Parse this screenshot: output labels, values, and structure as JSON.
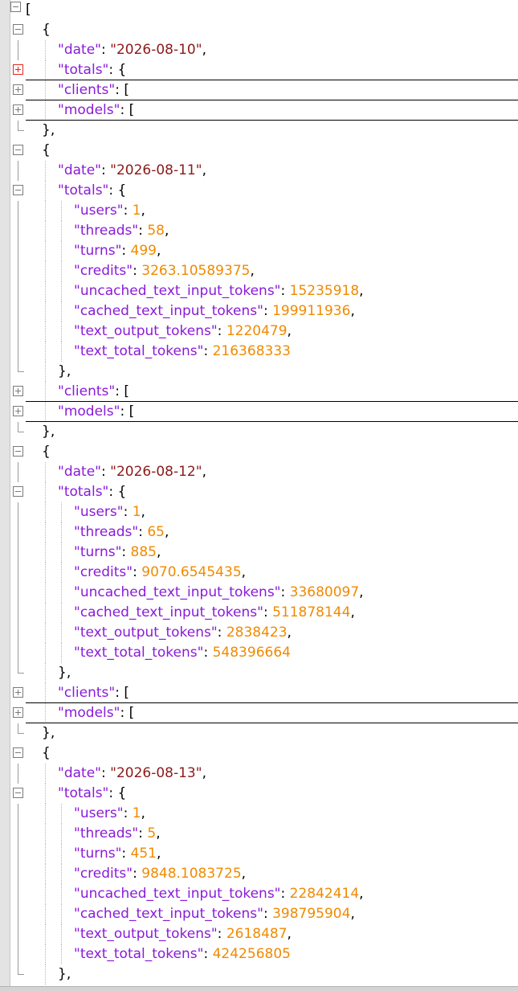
{
  "editor": {
    "open_bracket": "[",
    "comma": ",",
    "colon": ": ",
    "quote": "\"",
    "brace_open": "{",
    "brace_close_comma": "},",
    "bracket_open": "["
  },
  "records": [
    {
      "date": "2026-08-10",
      "totals_collapsed": true,
      "totals": []
    },
    {
      "date": "2026-08-11",
      "totals_collapsed": false,
      "totals": [
        {
          "key": "users",
          "value": "1"
        },
        {
          "key": "threads",
          "value": "58"
        },
        {
          "key": "turns",
          "value": "499"
        },
        {
          "key": "credits",
          "value": "3263.10589375"
        },
        {
          "key": "uncached_text_input_tokens",
          "value": "15235918"
        },
        {
          "key": "cached_text_input_tokens",
          "value": "199911936"
        },
        {
          "key": "text_output_tokens",
          "value": "1220479"
        },
        {
          "key": "text_total_tokens",
          "value": "216368333"
        }
      ]
    },
    {
      "date": "2026-08-12",
      "totals_collapsed": false,
      "totals": [
        {
          "key": "users",
          "value": "1"
        },
        {
          "key": "threads",
          "value": "65"
        },
        {
          "key": "turns",
          "value": "885"
        },
        {
          "key": "credits",
          "value": "9070.6545435"
        },
        {
          "key": "uncached_text_input_tokens",
          "value": "33680097"
        },
        {
          "key": "cached_text_input_tokens",
          "value": "511878144"
        },
        {
          "key": "text_output_tokens",
          "value": "2838423"
        },
        {
          "key": "text_total_tokens",
          "value": "548396664"
        }
      ]
    },
    {
      "date": "2026-08-13",
      "totals_collapsed": false,
      "totals": [
        {
          "key": "users",
          "value": "1"
        },
        {
          "key": "threads",
          "value": "5"
        },
        {
          "key": "turns",
          "value": "451"
        },
        {
          "key": "credits",
          "value": "9848.1083725"
        },
        {
          "key": "uncached_text_input_tokens",
          "value": "22842414"
        },
        {
          "key": "cached_text_input_tokens",
          "value": "398795904"
        },
        {
          "key": "text_output_tokens",
          "value": "2618487"
        },
        {
          "key": "text_total_tokens",
          "value": "424256805"
        }
      ]
    }
  ],
  "keys": {
    "date": "date",
    "totals": "totals",
    "clients": "clients",
    "models": "models"
  },
  "colors": {
    "key": "#8a1bd8",
    "string": "#8b1a1a",
    "number": "#f08a00",
    "punctuation": "#000000",
    "fold_marker": "#7a7a7a",
    "fold_marker_active": "#e0281e"
  }
}
